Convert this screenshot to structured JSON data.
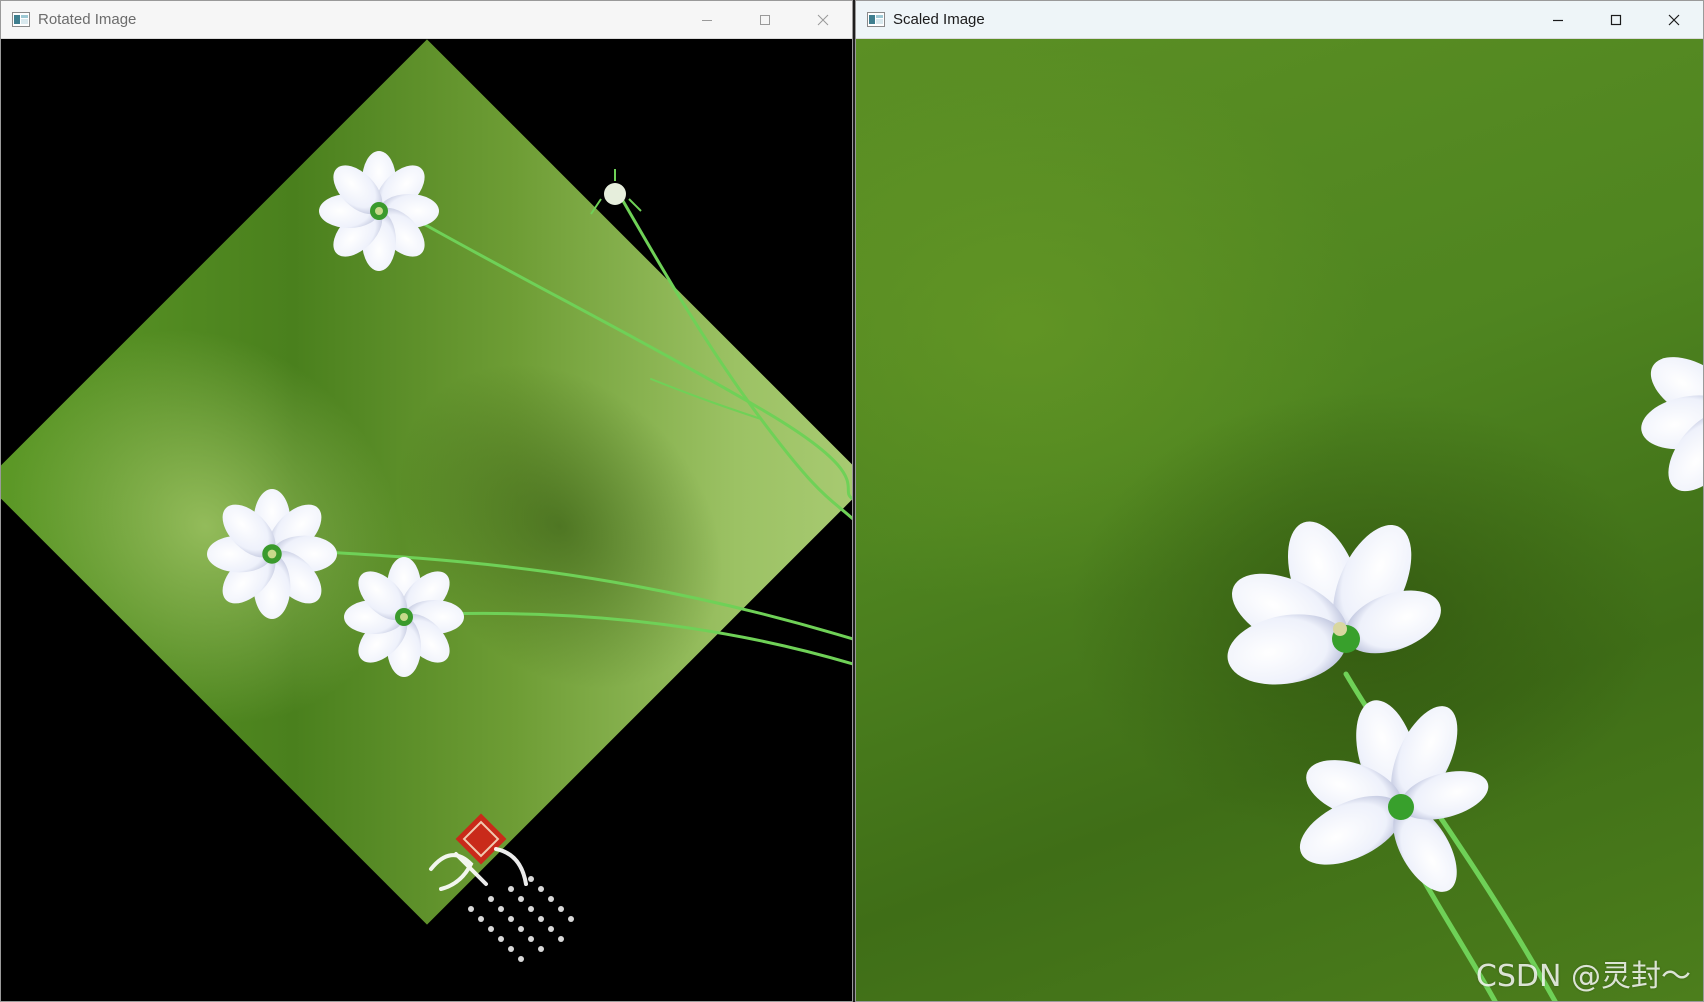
{
  "windows": {
    "rotated": {
      "title": "Rotated Image",
      "icon": "opencv-window-icon"
    },
    "scaled": {
      "title": "Scaled Image",
      "icon": "opencv-window-icon"
    }
  },
  "controls": {
    "minimize": "minimize-icon",
    "maximize": "maximize-icon",
    "close": "close-icon"
  },
  "watermark": {
    "text": "CSDN @灵封～"
  },
  "colors": {
    "background_green": "#4f8520",
    "light_green": "#a9cb73",
    "flower_white": "#f4f6fb",
    "stem_green": "#5fc94a",
    "seal_red": "#c92a1a"
  }
}
